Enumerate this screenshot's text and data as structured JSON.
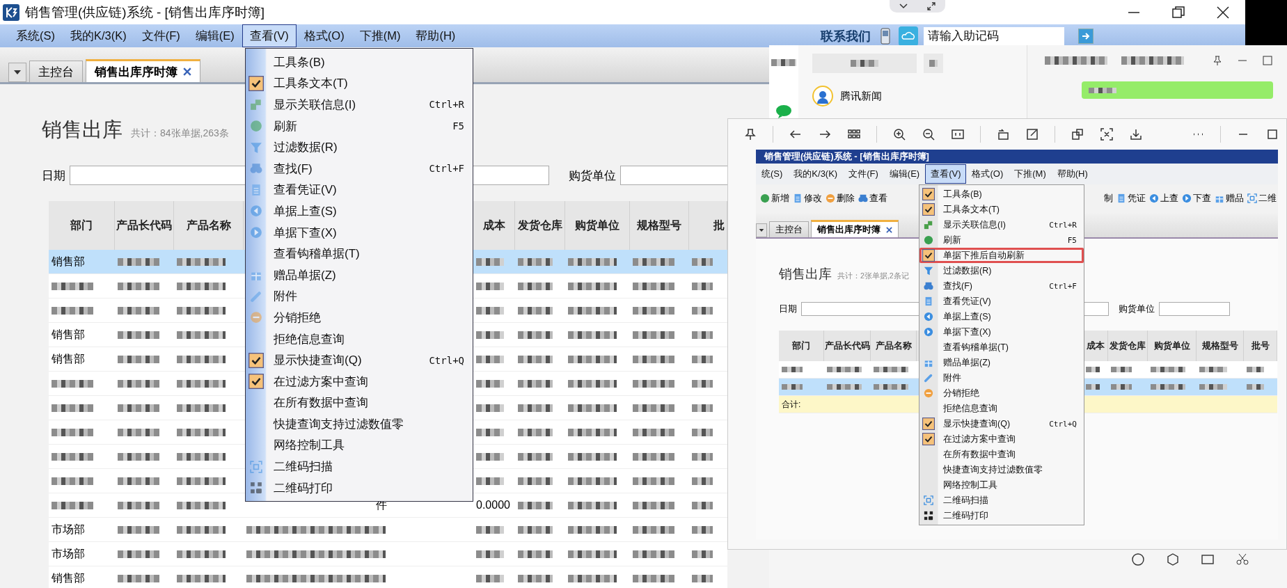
{
  "main_window": {
    "title": "销售管理(供应链)系统 - [销售出库序时簿]",
    "menu": [
      {
        "label": "系统(S)",
        "selected": false
      },
      {
        "label": "我的K/3(K)",
        "selected": false
      },
      {
        "label": "文件(F)",
        "selected": false
      },
      {
        "label": "编辑(E)",
        "selected": false
      },
      {
        "label": "查看(V)",
        "selected": true
      },
      {
        "label": "格式(O)",
        "selected": false
      },
      {
        "label": "下推(M)",
        "selected": false
      },
      {
        "label": "帮助(H)",
        "selected": false
      }
    ],
    "contact": "联系我们",
    "search": {
      "placeholder": "请输入助记码"
    },
    "tabs": [
      {
        "label": "主控台",
        "selected": false
      },
      {
        "label": "销售出库序时簿",
        "selected": true
      }
    ],
    "heading": "销售出库",
    "summary": "共计：84张单据,263条",
    "filters": [
      {
        "label": "日期"
      },
      {
        "label": "购货单位"
      }
    ],
    "table": {
      "columns": [
        "部门",
        "产品长代码",
        "产品名称",
        "成本",
        "发货仓库",
        "购货单位",
        "规格型号",
        "批"
      ],
      "rows": [
        {
          "department": "销售部",
          "selected": true
        },
        {
          "selected": false
        },
        {
          "selected": false
        },
        {
          "department": "销售部",
          "selected": false
        },
        {
          "department": "销售部",
          "selected": false
        },
        {
          "selected": false
        },
        {
          "selected": false
        },
        {
          "selected": false
        },
        {
          "selected": false
        },
        {
          "selected": false
        },
        {
          "unit": "件",
          "cost": "0.0000",
          "selected": false
        },
        {
          "department": "市场部",
          "selected": false
        },
        {
          "department": "市场部",
          "selected": false
        },
        {
          "department": "销售部",
          "selected": false
        }
      ]
    },
    "view_menu": [
      {
        "label": "工具条(B)",
        "checked": false
      },
      {
        "label": "工具条文本(T)",
        "checked": true
      },
      {
        "label": "显示关联信息(I)",
        "shortcut": "Ctrl+R",
        "checked": false
      },
      {
        "label": "刷新",
        "shortcut": "F5",
        "checked": false
      },
      {
        "label": "过滤数据(R)",
        "checked": false
      },
      {
        "label": "查找(F)",
        "shortcut": "Ctrl+F",
        "checked": false
      },
      {
        "label": "查看凭证(V)",
        "checked": false
      },
      {
        "label": "单据上查(S)",
        "checked": false
      },
      {
        "label": "单据下查(X)",
        "checked": false
      },
      {
        "label": "查看钩稽单据(T)",
        "checked": false
      },
      {
        "label": "赠品单据(Z)",
        "checked": false
      },
      {
        "label": "附件",
        "checked": false
      },
      {
        "label": "分销拒绝",
        "checked": false
      },
      {
        "label": "拒绝信息查询",
        "checked": false
      },
      {
        "label": "显示快捷查询(Q)",
        "shortcut": "Ctrl+Q",
        "checked": true
      },
      {
        "label": "在过滤方案中查询",
        "checked": true
      },
      {
        "label": "在所有数据中查询",
        "checked": false
      },
      {
        "label": "快捷查询支持过滤数值零",
        "checked": false
      },
      {
        "label": "网络控制工具",
        "checked": false
      },
      {
        "label": "二维码扫描",
        "checked": false
      },
      {
        "label": "二维码打印",
        "checked": false
      }
    ]
  },
  "chat_window": {
    "contact": "腾讯新闻"
  },
  "image_viewer": {
    "screenshot": {
      "title": "销售管理(供应链)系统 - [销售出库序时簿]",
      "menu": [
        {
          "label": "统(S)",
          "selected": false
        },
        {
          "label": "我的K/3(K)",
          "selected": false
        },
        {
          "label": "文件(F)",
          "selected": false
        },
        {
          "label": "编辑(E)",
          "selected": false
        },
        {
          "label": "查看(V)",
          "selected": true
        },
        {
          "label": "格式(O)",
          "selected": false
        },
        {
          "label": "下推(M)",
          "selected": false
        },
        {
          "label": "帮助(H)",
          "selected": false
        }
      ],
      "toolbar_left": [
        "新增",
        "修改",
        "删除",
        "查看"
      ],
      "toolbar_right": [
        "制",
        "凭证",
        "上查",
        "下查",
        "赠品",
        "二维"
      ],
      "tabs": [
        {
          "label": "主控台",
          "selected": false
        },
        {
          "label": "销售出库序时簿",
          "selected": true
        }
      ],
      "heading": "销售出库",
      "summary": "共计：2张单据,2条记",
      "filters": [
        {
          "label": "日期"
        },
        {
          "label": "购货单位"
        }
      ],
      "table": {
        "columns": [
          "部门",
          "产品长代码",
          "产品名称",
          "成本",
          "发货仓库",
          "购货单位",
          "规格型号",
          "批号"
        ],
        "rows": [
          {
            "selected": false
          },
          {
            "selected": true
          }
        ],
        "total_label": "合计:"
      },
      "view_menu": [
        {
          "label": "工具条(B)",
          "checked": true,
          "highlighted": false
        },
        {
          "label": "工具条文本(T)",
          "checked": true,
          "highlighted": false
        },
        {
          "label": "显示关联信息(I)",
          "shortcut": "Ctrl+R",
          "checked": false,
          "highlighted": false
        },
        {
          "label": "刷新",
          "shortcut": "F5",
          "checked": false,
          "highlighted": false
        },
        {
          "label": "单据下推后自动刷新",
          "checked": true,
          "highlighted": true
        },
        {
          "label": "过滤数据(R)",
          "checked": false,
          "highlighted": false
        },
        {
          "label": "查找(F)",
          "shortcut": "Ctrl+F",
          "checked": false,
          "highlighted": false
        },
        {
          "label": "查看凭证(V)",
          "checked": false,
          "highlighted": false
        },
        {
          "label": "单据上查(S)",
          "checked": false,
          "highlighted": false
        },
        {
          "label": "单据下查(X)",
          "checked": false,
          "highlighted": false
        },
        {
          "label": "查看钩稽单据(T)",
          "checked": false,
          "highlighted": false
        },
        {
          "label": "赠品单据(Z)",
          "checked": false,
          "highlighted": false
        },
        {
          "label": "附件",
          "checked": false,
          "highlighted": false
        },
        {
          "label": "分销拒绝",
          "checked": false,
          "highlighted": false
        },
        {
          "label": "拒绝信息查询",
          "checked": false,
          "highlighted": false
        },
        {
          "label": "显示快捷查询(Q)",
          "shortcut": "Ctrl+Q",
          "checked": true,
          "highlighted": false
        },
        {
          "label": "在过滤方案中查询",
          "checked": true,
          "highlighted": false
        },
        {
          "label": "在所有数据中查询",
          "checked": false,
          "highlighted": false
        },
        {
          "label": "快捷查询支持过滤数值零",
          "checked": false,
          "highlighted": false
        },
        {
          "label": "网络控制工具",
          "checked": false,
          "highlighted": false
        },
        {
          "label": "二维码扫描",
          "checked": false,
          "highlighted": false
        },
        {
          "label": "二维码打印",
          "checked": false,
          "highlighted": false
        }
      ]
    }
  }
}
